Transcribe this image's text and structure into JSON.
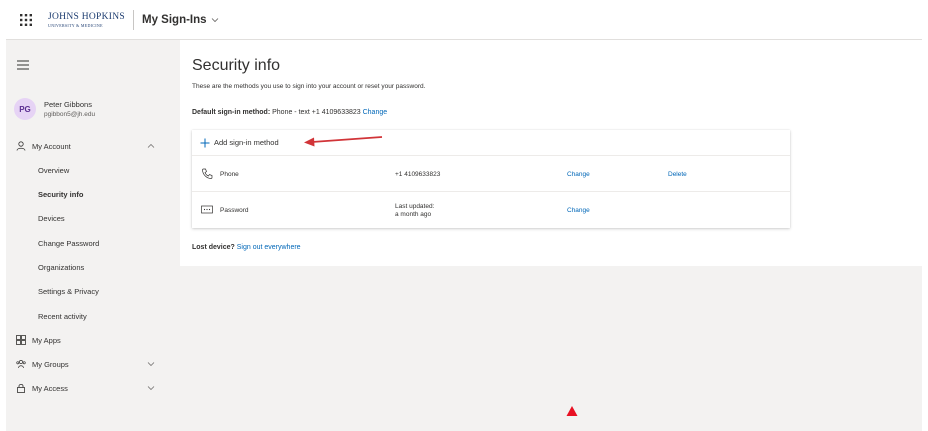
{
  "header": {
    "logo_line1": "JOHNS HOPKINS",
    "logo_line2": "UNIVERSITY & MEDICINE",
    "app_title": "My Sign-Ins"
  },
  "profile": {
    "initials": "PG",
    "name": "Peter Gibbons",
    "email": "pgibbon5@jh.edu"
  },
  "sidebar": {
    "my_account": "My Account",
    "sub_items": [
      "Overview",
      "Security info",
      "Devices",
      "Change Password",
      "Organizations",
      "Settings & Privacy",
      "Recent activity"
    ],
    "active_item": "Security info",
    "my_apps": "My Apps",
    "my_groups": "My Groups",
    "my_access": "My Access"
  },
  "main": {
    "title": "Security info",
    "subtitle": "These are the methods you use to sign into your account or reset your password.",
    "default_label": "Default sign-in method:",
    "default_value": " Phone - text +1 4109633823 ",
    "default_change": "Change",
    "add_method": "Add sign-in method",
    "methods": [
      {
        "name": "Phone",
        "detail": "+1 4109633823",
        "change": "Change",
        "delete": "Delete"
      },
      {
        "name": "Password",
        "detail_line1": "Last updated:",
        "detail_line2": "a month ago",
        "change": "Change"
      }
    ],
    "lost_device_label": "Lost device?",
    "lost_device_link": " Sign out everywhere"
  },
  "colors": {
    "accent": "#0067b8",
    "annotation": "#d13438",
    "background": "#f3f2f1"
  }
}
